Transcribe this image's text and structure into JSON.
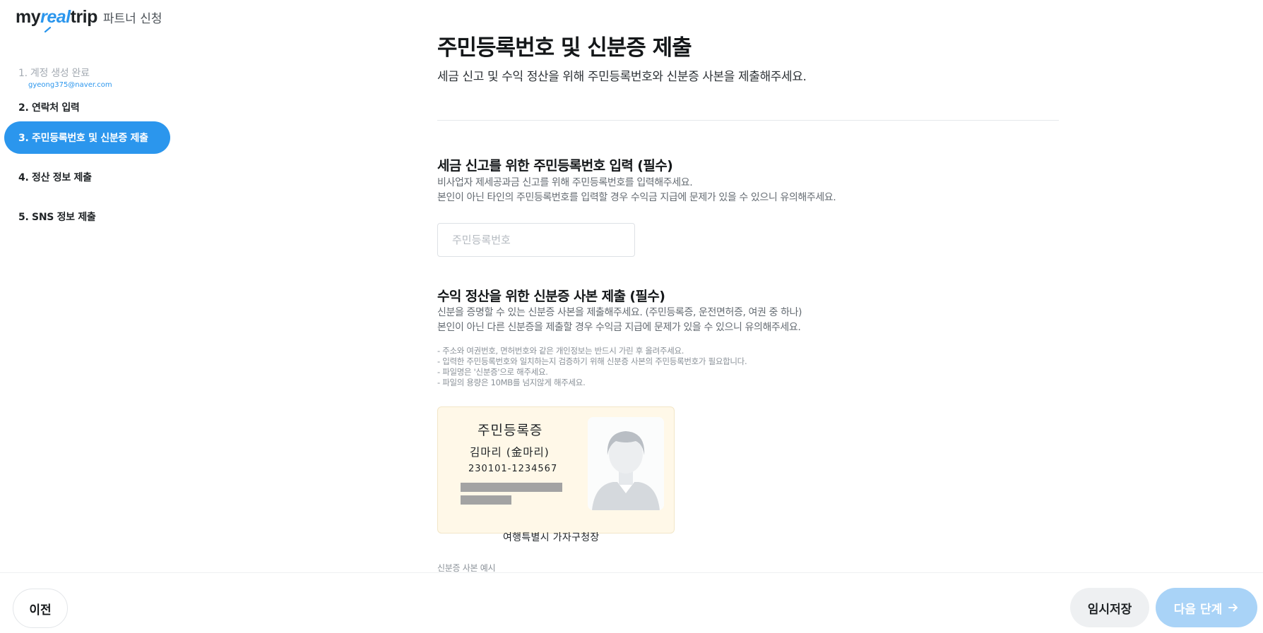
{
  "brand": {
    "logo_my": "my",
    "logo_real": "real",
    "logo_trip": "trip",
    "subtitle": "파트너 신청"
  },
  "steps": [
    {
      "label": "1. 계정 생성 완료",
      "email": "gyeong375@naver.com",
      "state": "done"
    },
    {
      "label": "2. 연락처 입력",
      "state": "default"
    },
    {
      "label": "3. 주민등록번호 및 신분증 제출",
      "state": "active"
    },
    {
      "label": "4. 정산 정보 제출",
      "state": "default"
    },
    {
      "label": "5. SNS 정보 제출",
      "state": "default"
    }
  ],
  "main": {
    "title": "주민등록번호 및 신분증 제출",
    "description": "세금 신고 및 수익 정산을 위해 주민등록번호와 신분증 사본을 제출해주세요.",
    "rrn_section": {
      "title": "세금 신고를 위한 주민등록번호 입력 (필수)",
      "desc_lines": [
        "비사업자 제세공과금 신고를 위해 주민등록번호를 입력해주세요.",
        "본인이 아닌 타인의 주민등록번호를 입력할 경우 수익금 지급에 문제가 있을 수 있으니 유의해주세요."
      ],
      "input_value": "",
      "input_placeholder": "주민등록번호"
    },
    "id_section": {
      "title": "수익 정산을 위한 신분증 사본 제출 (필수)",
      "desc_lines": [
        "신분을 증명할 수 있는 신분증 사본을 제출해주세요. (주민등록증, 운전면허증, 여권 중 하나)",
        "본인이 아닌 다른 신분증을 제출할 경우 수익금 지급에 문제가 있을 수 있으니 유의해주세요."
      ],
      "notes": [
        "- 주소와 여권번호, 면허번호와 같은 개인정보는 반드시 가린 후 올려주세요.",
        "- 입력한 주민등록번호와 일치하는지 검증하기 위해 신분증 사본의 주민등록번호가 필요합니다.",
        "- 파일명은 '신분증'으로 해주세요.",
        "- 파일의 용량은 10MB를 넘지않게 해주세요."
      ],
      "card": {
        "title": "주민등록증",
        "name": "김마리 (金마리)",
        "number": "230101-1234567",
        "issuer": "여행특별시 가자구청장"
      },
      "caption": "신분증 사본 예시"
    }
  },
  "footer": {
    "prev_label": "이전",
    "save_label": "임시저장",
    "next_label": "다음 단계"
  },
  "colors": {
    "accent": "#2b96ed",
    "accent_disabled": "#a9d3f7",
    "card_bg": "#fff8e8"
  }
}
